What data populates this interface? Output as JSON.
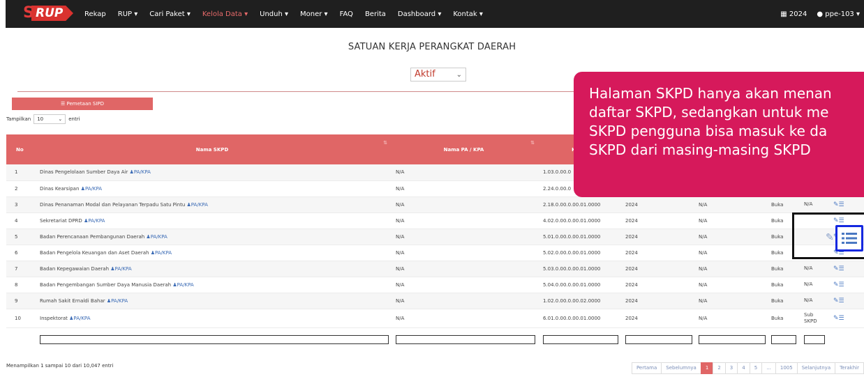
{
  "navbar": {
    "logo": {
      "s": "S",
      "rup": "RUP"
    },
    "items": [
      {
        "label": "Rekap",
        "active": false
      },
      {
        "label": "RUP ▾",
        "active": false
      },
      {
        "label": "Cari Paket ▾",
        "active": false
      },
      {
        "label": "Kelola Data ▾",
        "active": true
      },
      {
        "label": "Unduh ▾",
        "active": false
      },
      {
        "label": "Moner ▾",
        "active": false
      },
      {
        "label": "FAQ",
        "active": false
      },
      {
        "label": "Berita",
        "active": false
      },
      {
        "label": "Dashboard ▾",
        "active": false
      },
      {
        "label": "Kontak ▾",
        "active": false
      }
    ],
    "year": "2024",
    "user": "ppe-103 ▾"
  },
  "page": {
    "title": "SATUAN KERJA PERANGKAT DAERAH",
    "status_value": "Aktif"
  },
  "toolbar": {
    "map_button": "Pemetaan SIPD",
    "show_prefix": "Tampilkan",
    "show_value": "10",
    "show_suffix": "entri"
  },
  "table": {
    "headers": [
      "No",
      "Nama SKPD",
      "Nama PA / KPA",
      "Kode"
    ],
    "pakpa_label": "PA/KPA",
    "rows": [
      {
        "no": "1",
        "name": "Dinas Pengelolaan Sumber Daya Air",
        "pa": "N/A",
        "code": "1.03.0.00.0",
        "year": "",
        "ppk": "",
        "status": "",
        "sub": "",
        "tall": false
      },
      {
        "no": "2",
        "name": "Dinas Kearsipan",
        "pa": "N/A",
        "code": "2.24.0.00.0",
        "year": "",
        "ppk": "",
        "status": "",
        "sub": "",
        "tall": false
      },
      {
        "no": "3",
        "name": "Dinas Penanaman Modal dan Pelayanan Terpadu Satu Pintu",
        "pa": "N/A",
        "code": "2.18.0.00.0.00.01.0000",
        "year": "2024",
        "ppk": "N/A",
        "status": "Buka",
        "sub": "N/A",
        "tall": false
      },
      {
        "no": "4",
        "name": "Sekretariat DPRD",
        "pa": "N/A",
        "code": "4.02.0.00.0.00.01.0000",
        "year": "2024",
        "ppk": "N/A",
        "status": "Buka",
        "sub": "",
        "tall": false
      },
      {
        "no": "5",
        "name": "Badan Perencanaan Pembangunan Daerah",
        "pa": "N/A",
        "code": "5.01.0.00.0.00.01.0000",
        "year": "2024",
        "ppk": "N/A",
        "status": "Buka",
        "sub": "",
        "tall": false
      },
      {
        "no": "6",
        "name": "Badan Pengelola Keuangan dan Aset Daerah",
        "pa": "N/A",
        "code": "5.02.0.00.0.00.01.0000",
        "year": "2024",
        "ppk": "N/A",
        "status": "Buka",
        "sub": "",
        "tall": false
      },
      {
        "no": "7",
        "name": "Badan Kepegawaian Daerah",
        "pa": "N/A",
        "code": "5.03.0.00.0.00.01.0000",
        "year": "2024",
        "ppk": "N/A",
        "status": "Buka",
        "sub": "N/A",
        "tall": false
      },
      {
        "no": "8",
        "name": "Badan Pengembangan Sumber Daya Manusia Daerah",
        "pa": "N/A",
        "code": "5.04.0.00.0.00.01.0000",
        "year": "2024",
        "ppk": "N/A",
        "status": "Buka",
        "sub": "N/A",
        "tall": false
      },
      {
        "no": "9",
        "name": "Rumah Sakit Ernaldi Bahar",
        "pa": "N/A",
        "code": "1.02.0.00.0.00.02.0000",
        "year": "2024",
        "ppk": "N/A",
        "status": "Buka",
        "sub": "N/A",
        "tall": false
      },
      {
        "no": "10",
        "name": "Inspektorat",
        "pa": "N/A",
        "code": "6.01.0.00.0.00.01.0000",
        "year": "2024",
        "ppk": "N/A",
        "status": "Buka",
        "sub": "Sub SKPD",
        "tall": true
      }
    ]
  },
  "footer": {
    "info": "Menampilkan 1 sampai 10 dari 10,047 entri",
    "pages": [
      "Pertama",
      "Sebelumnya",
      "1",
      "2",
      "3",
      "4",
      "5",
      "...",
      "1005",
      "Selanjutnya",
      "Terakhir"
    ],
    "current_page": "1"
  },
  "tooltip": {
    "lines": [
      "Halaman SKPD hanya akan menan",
      "daftar SKPD, sedangkan untuk me",
      "SKPD pengguna bisa masuk ke da",
      "SKPD dari masing-masing SKPD"
    ]
  },
  "colors": {
    "navbar": "#1f1f1f",
    "accent": "#e06666",
    "tooltip": "#d6195b",
    "highlight": "#1428e0"
  },
  "icons": [
    "calendar-icon",
    "user-icon",
    "list-icon",
    "edit-icon",
    "person-icon"
  ]
}
